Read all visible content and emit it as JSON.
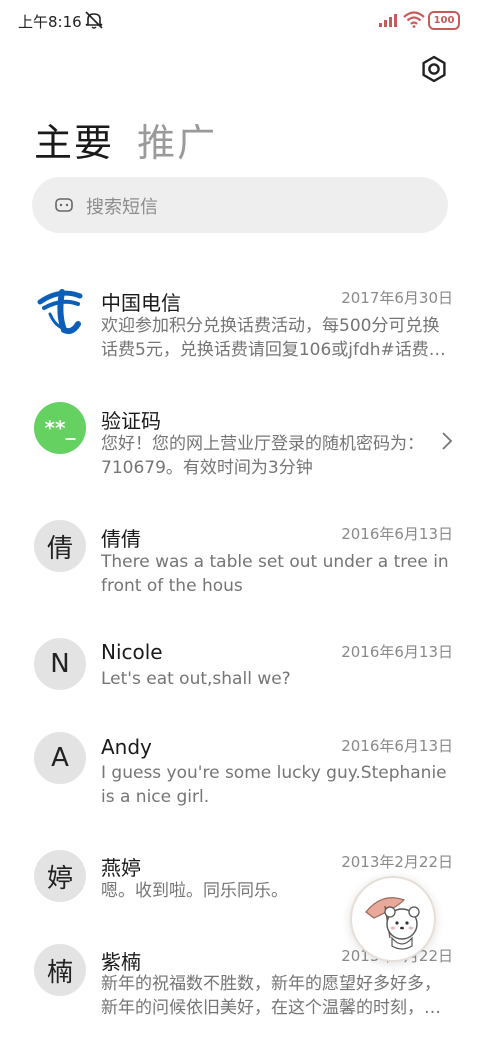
{
  "status_bar": {
    "time": "上午8:16",
    "battery": "100"
  },
  "tabs": [
    {
      "label": "主要",
      "active": true
    },
    {
      "label": "推广",
      "active": false
    }
  ],
  "search": {
    "placeholder": "搜索短信"
  },
  "conversations": [
    {
      "name": "中国电信",
      "date": "2017年6月30日",
      "preview": "欢迎参加积分兑换话费活动，每500分可兑换话费5元，兑换话费请回复106或jfdh#话费…",
      "avatar": "china-telecom-logo"
    },
    {
      "name": "验证码",
      "date": "",
      "preview": "您好！您的网上营业厅登录的随机密码为：710679。有效时间为3分钟",
      "avatar": "**_"
    },
    {
      "name": "倩倩",
      "date": "2016年6月13日",
      "preview": "There was a table set out under a tree in front of the hous",
      "avatar": "倩"
    },
    {
      "name": "Nicole",
      "date": "2016年6月13日",
      "preview": "Let's eat out,shall we?",
      "avatar": "N"
    },
    {
      "name": "Andy",
      "date": "2016年6月13日",
      "preview": "I guess you're some lucky guy.Stephanie is a nice girl.",
      "avatar": "A"
    },
    {
      "name": "燕婷",
      "date": "2013年2月22日",
      "preview": "嗯。收到啦。同乐同乐。",
      "avatar": "婷"
    },
    {
      "name": "紫楠",
      "date": "2013年2月22日",
      "preview": "新年的祝福数不胜数，新年的愿望好多好多，新年的问候依旧美好，在这个温馨的时刻，…",
      "avatar": "楠"
    }
  ],
  "colors": {
    "verify_avatar": "#64d161",
    "telecom_blue": "#0b5fb8",
    "battery": "#c85a5a"
  }
}
